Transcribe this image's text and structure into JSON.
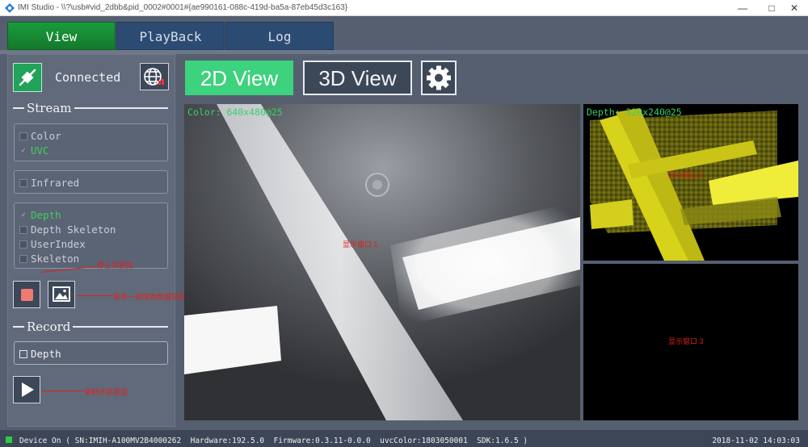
{
  "window": {
    "title": "IMI Studio - \\\\?\\usb#vid_2dbb&pid_0002#0001#{ae990161-088c-419d-ba5a-87eb45d3c163}",
    "icons": {
      "app": "app-logo-icon",
      "minimize": "minimize-icon",
      "maximize": "maximize-icon",
      "close": "close-icon"
    }
  },
  "tabs": [
    {
      "label": "View",
      "active": true
    },
    {
      "label": "PlayBack",
      "active": false
    },
    {
      "label": "Log",
      "active": false
    }
  ],
  "sidebar": {
    "connection_status": "Connected",
    "stream_title": "Stream",
    "stream_groups": [
      [
        {
          "label": "Color",
          "checked": false
        },
        {
          "label": "UVC",
          "checked": true
        }
      ],
      [
        {
          "label": "Infrared",
          "checked": false
        }
      ],
      [
        {
          "label": "Depth",
          "checked": true
        },
        {
          "label": "Depth Skeleton",
          "checked": false
        },
        {
          "label": "UserIndex",
          "checked": false
        },
        {
          "label": "Skeleton",
          "checked": false
        }
      ]
    ],
    "record_title": "Record",
    "record_item": "Depth",
    "icons": {
      "connect": "plug-icon",
      "network": "network-icon",
      "stop": "stop-icon",
      "snapshot": "image-icon",
      "play": "play-icon"
    }
  },
  "annotations": {
    "stop": "停止读预览",
    "snapshot": "保存一帧原始数据及图片",
    "play": "录制开启按钮"
  },
  "toolbar": {
    "view2d_label": "2D View",
    "view3d_label": "3D View",
    "settings_icon": "gear-icon",
    "accent": "#3dd27d"
  },
  "views": {
    "color_label": "Color: 640x480@25",
    "depth_label": "Depth: 320x240@25",
    "window1_caption": "显示窗口 1",
    "window2_caption": "显示窗口 2",
    "window3_caption": "显示窗口 3"
  },
  "status": {
    "text": "Device On ( SN:IMIH-A100MV2B4000262  Hardware:192.5.0  Firmware:0.3.11-0.0.0  uvcColor:1803050001  SDK:1.6.5 )",
    "datetime": "2018-11-02 14:03:03",
    "led_color": "#2ecc40"
  }
}
